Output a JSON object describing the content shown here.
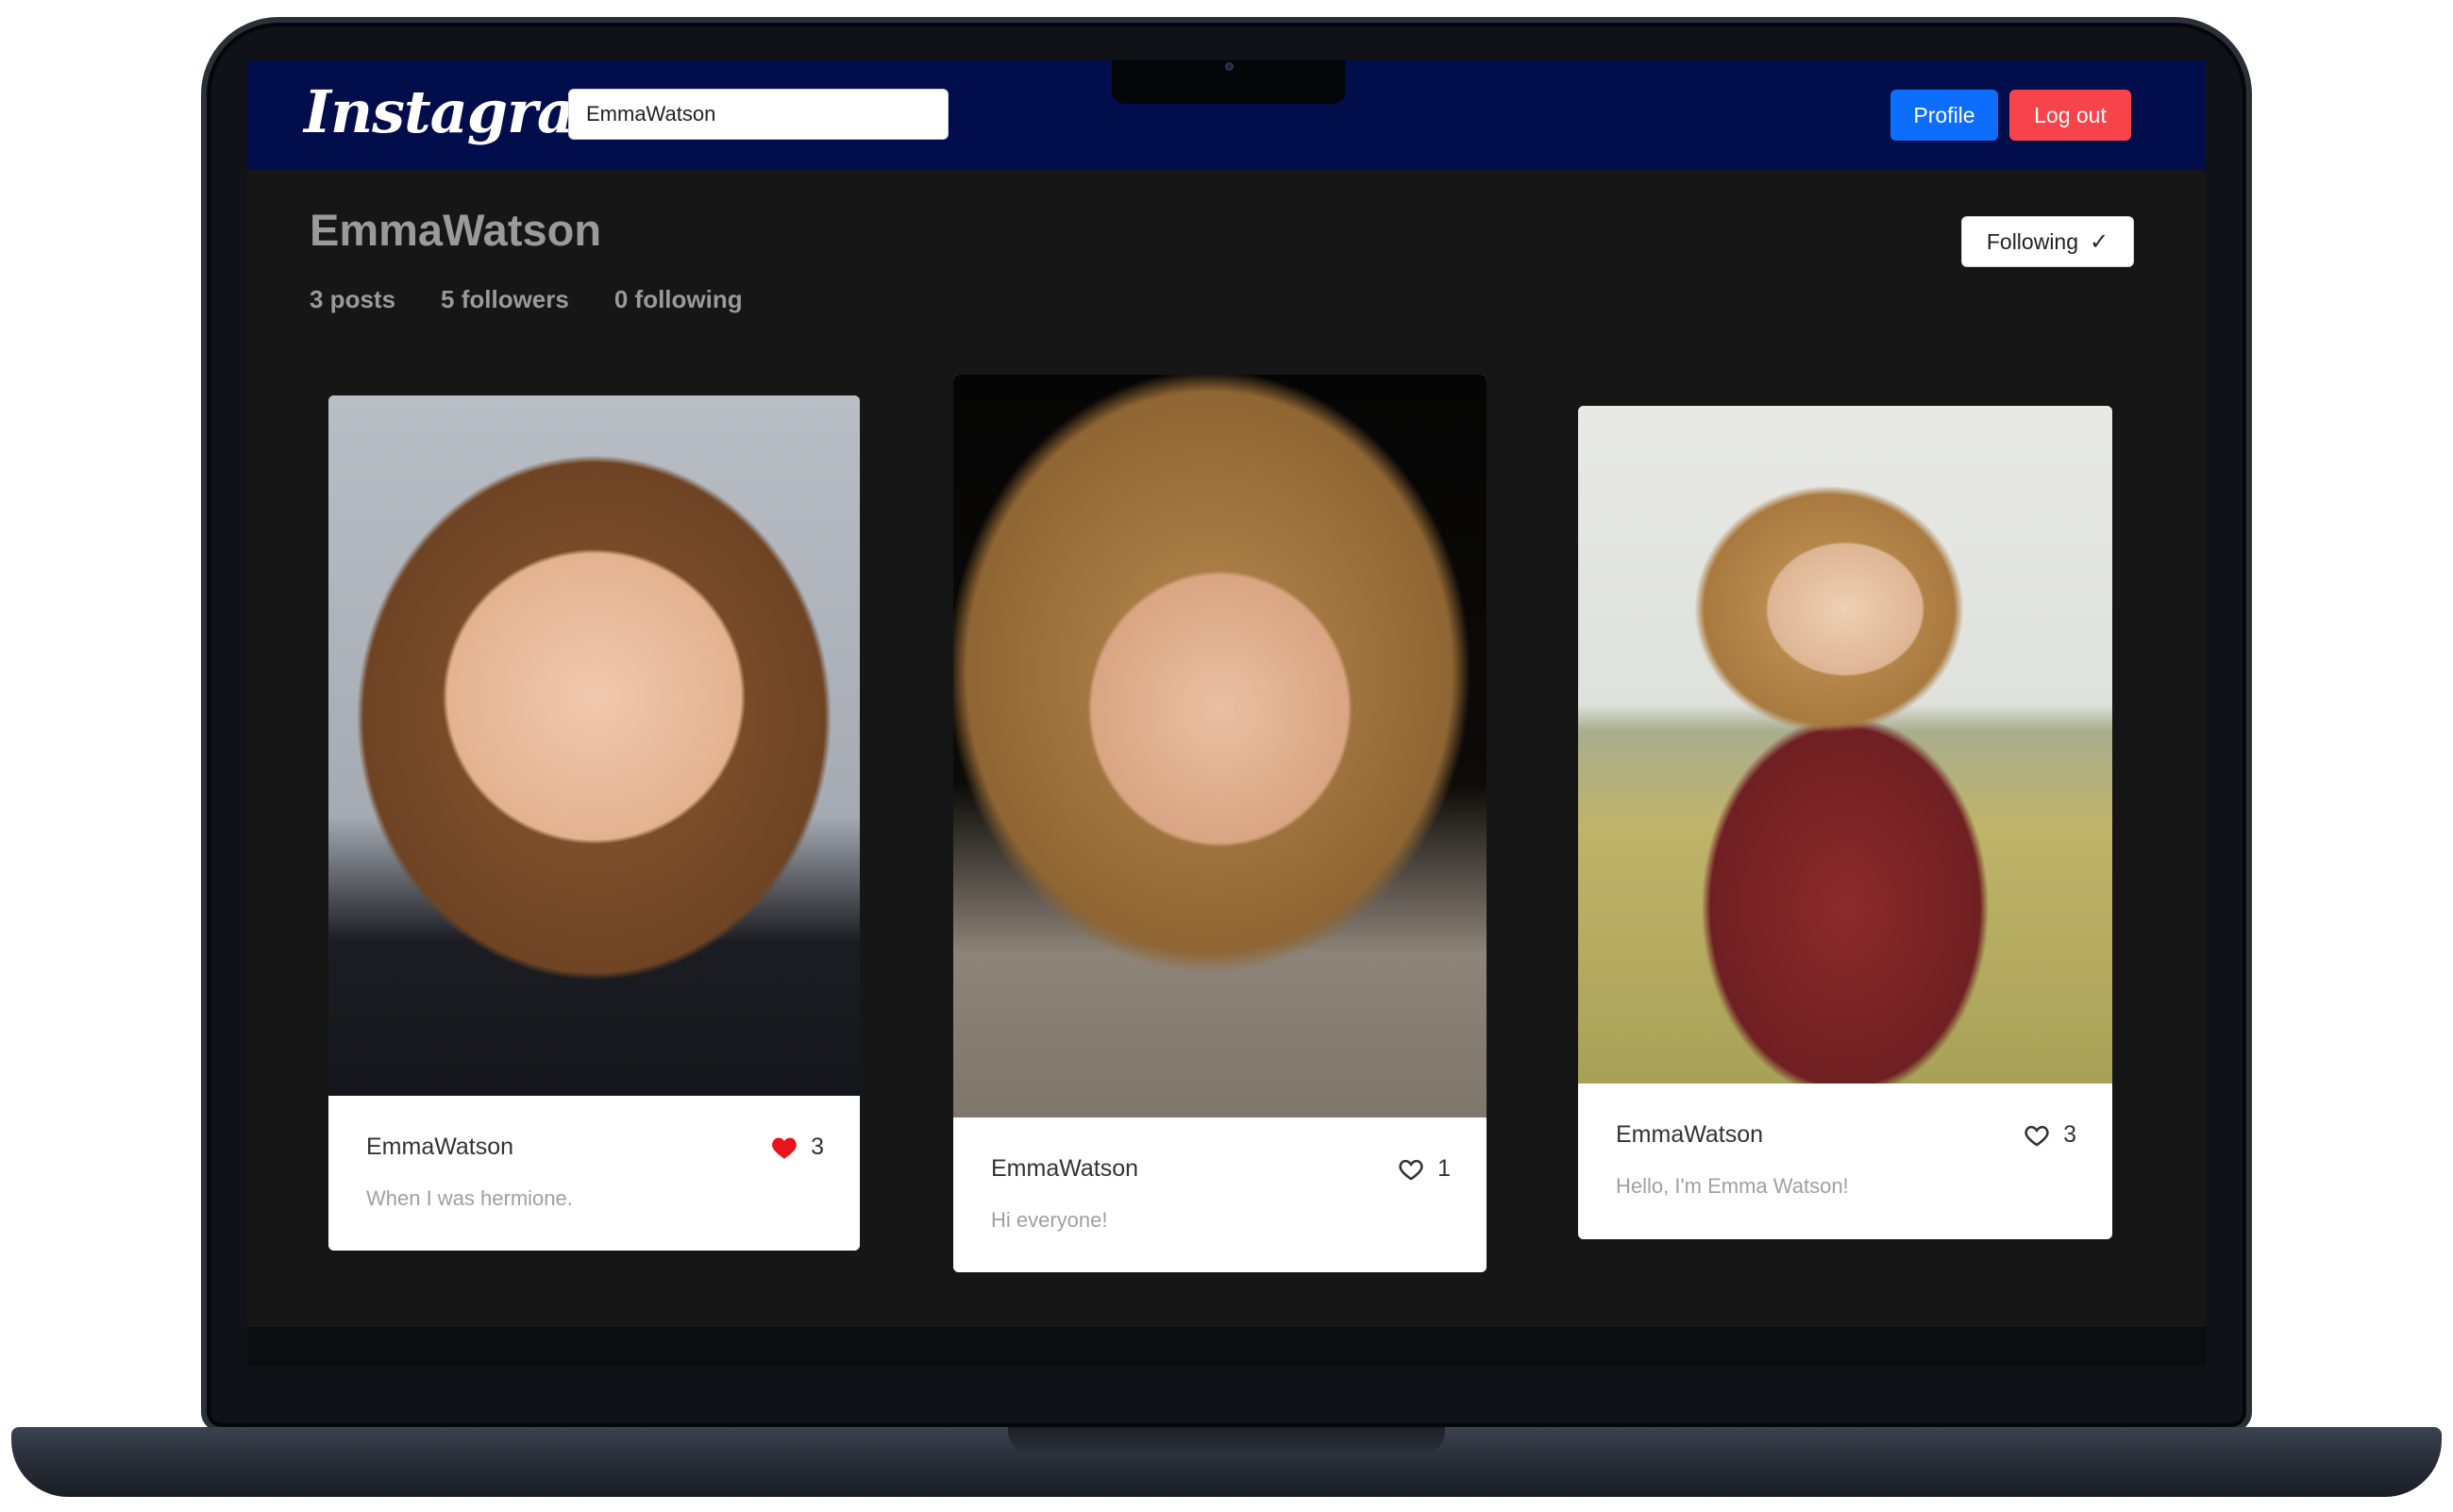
{
  "app": {
    "brand": "Instagram"
  },
  "navbar": {
    "search_value": "EmmaWatson",
    "profile_label": "Profile",
    "logout_label": "Log out"
  },
  "profile": {
    "username": "EmmaWatson",
    "posts": "3 posts",
    "followers": "5 followers",
    "following": "0 following",
    "follow_button_label": "Following",
    "follow_button_icon": "check-icon"
  },
  "posts": [
    {
      "username": "EmmaWatson",
      "caption": "When I was hermione.",
      "likes": "3",
      "liked": true,
      "heart_color": "#e8141c"
    },
    {
      "username": "EmmaWatson",
      "caption": "Hi everyone!",
      "likes": "1",
      "liked": false
    },
    {
      "username": "EmmaWatson",
      "caption": "Hello, I'm Emma Watson!",
      "likes": "3",
      "liked": false
    }
  ],
  "colors": {
    "navbar_bg": "#020d4c",
    "page_bg": "#161616",
    "profile_button": "#0d6efd",
    "logout_button": "#f7434a"
  }
}
